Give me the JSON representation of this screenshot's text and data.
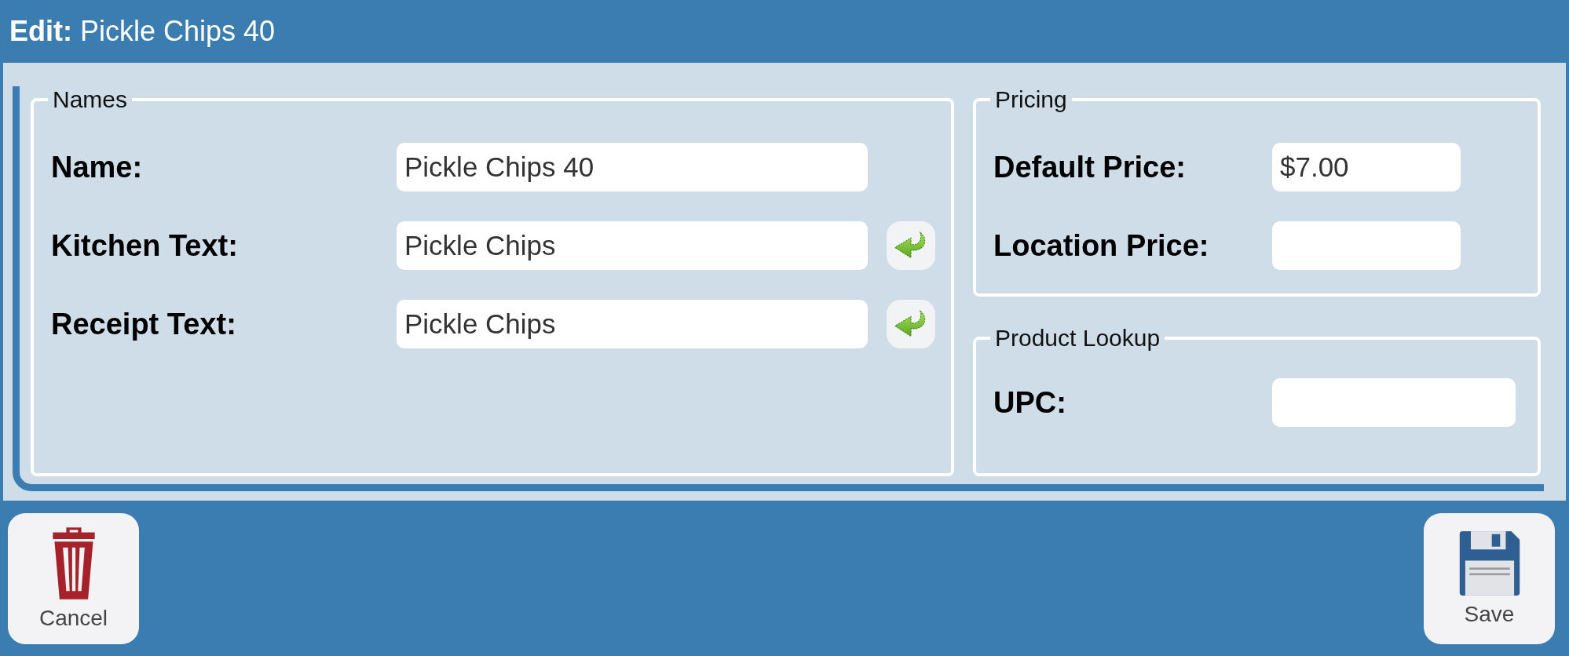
{
  "window": {
    "title": "**Edit:** Pickle Chips 40"
  },
  "names": {
    "legend": "Names",
    "fields": [
      {
        "label": "Name:",
        "value": "Pickle Chips 40",
        "copy_button": false
      },
      {
        "label": "Kitchen Text:",
        "value": "Pickle Chips",
        "copy_button": true
      },
      {
        "label": "Receipt Text:",
        "value": "Pickle Chips",
        "copy_button": true
      }
    ]
  },
  "pricing": {
    "legend": "Pricing",
    "fields": [
      {
        "label": "Default Price:",
        "value": "$7.00"
      },
      {
        "label": "Location Price:"
      }
    ]
  },
  "product_lookup": {
    "legend": "Product Lookup",
    "fields": [
      {
        "label": "UPC:"
      }
    ]
  },
  "buttons": [
    {
      "kind": "delete",
      "label": "Cancel"
    },
    {
      "kind": "save",
      "label": "Save"
    }
  ]
}
